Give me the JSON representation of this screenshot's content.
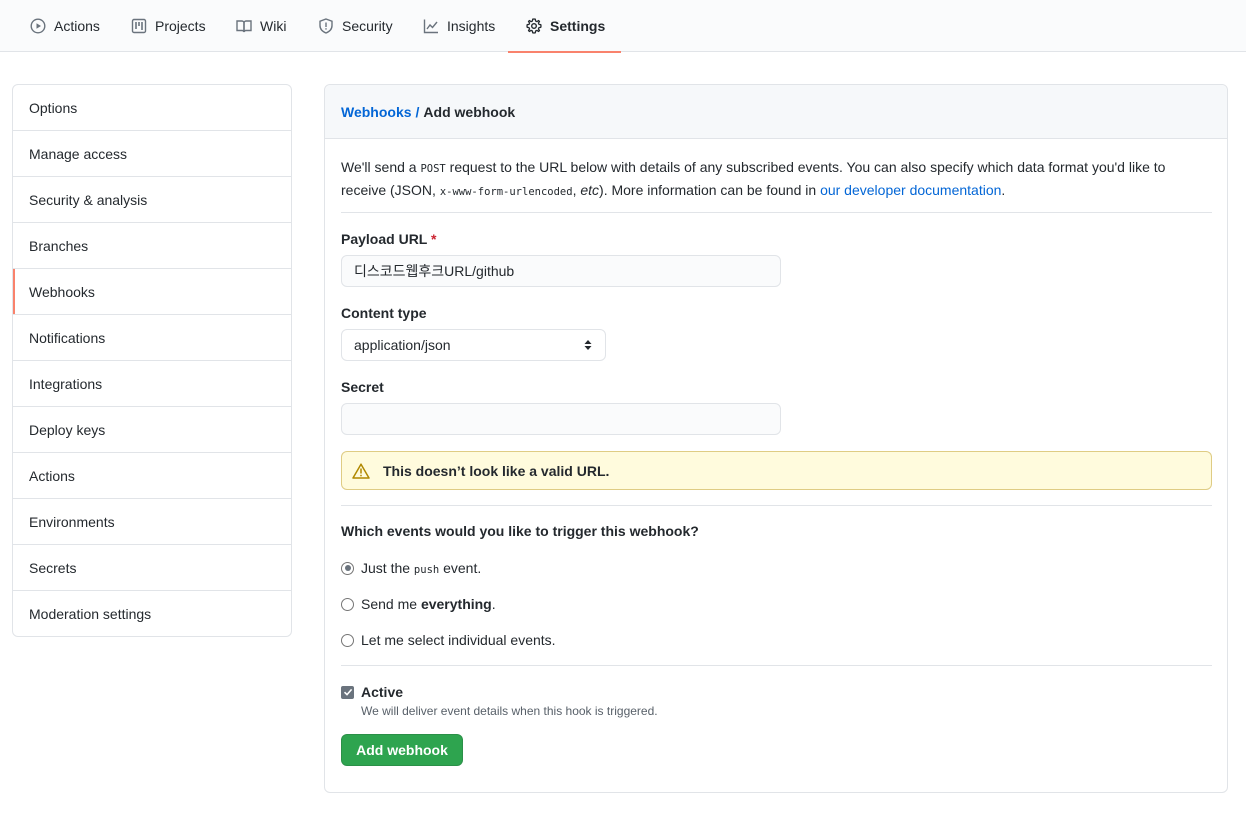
{
  "nav": {
    "tabs": [
      {
        "label": "Actions",
        "icon": "play-icon"
      },
      {
        "label": "Projects",
        "icon": "project-icon"
      },
      {
        "label": "Wiki",
        "icon": "book-icon"
      },
      {
        "label": "Security",
        "icon": "shield-icon"
      },
      {
        "label": "Insights",
        "icon": "graph-icon"
      },
      {
        "label": "Settings",
        "icon": "gear-icon",
        "selected": true
      }
    ]
  },
  "sidebar": {
    "items": [
      {
        "label": "Options"
      },
      {
        "label": "Manage access"
      },
      {
        "label": "Security & analysis"
      },
      {
        "label": "Branches"
      },
      {
        "label": "Webhooks",
        "active": true
      },
      {
        "label": "Notifications"
      },
      {
        "label": "Integrations"
      },
      {
        "label": "Deploy keys"
      },
      {
        "label": "Actions"
      },
      {
        "label": "Environments"
      },
      {
        "label": "Secrets"
      },
      {
        "label": "Moderation settings"
      }
    ]
  },
  "breadcrumb": {
    "parent": "Webhooks",
    "separator": "/",
    "current": "Add webhook"
  },
  "intro": {
    "part1": "We'll send a ",
    "code1": "POST",
    "part2": " request to the URL below with details of any subscribed events. You can also specify which data format you'd like to receive (JSON, ",
    "code2": "x-www-form-urlencoded",
    "part3": ", ",
    "etc": "etc",
    "part4": "). More information can be found in ",
    "link": "our developer documentation",
    "part5": "."
  },
  "form": {
    "payload_label": "Payload URL",
    "required_mark": "*",
    "payload_value": "디스코드웹후크URL/github",
    "content_type_label": "Content type",
    "content_type_value": "application/json",
    "secret_label": "Secret",
    "secret_value": "",
    "warning": "This doesn’t look like a valid URL.",
    "events_question": "Which events would you like to trigger this webhook?",
    "radio_push_pre": "Just the ",
    "radio_push_code": "push",
    "radio_push_post": " event.",
    "radio_all_pre": "Send me ",
    "radio_all_bold": "everything",
    "radio_all_post": ".",
    "radio_select": "Let me select individual events.",
    "active_label": "Active",
    "active_note": "We will deliver event details when this hook is triggered.",
    "submit_label": "Add webhook"
  },
  "colors": {
    "accent_underline": "#f9826c",
    "link": "#0366d6",
    "primary_button": "#2ea44f",
    "warning_bg": "#fffbdd",
    "warning_icon": "#b08800"
  }
}
